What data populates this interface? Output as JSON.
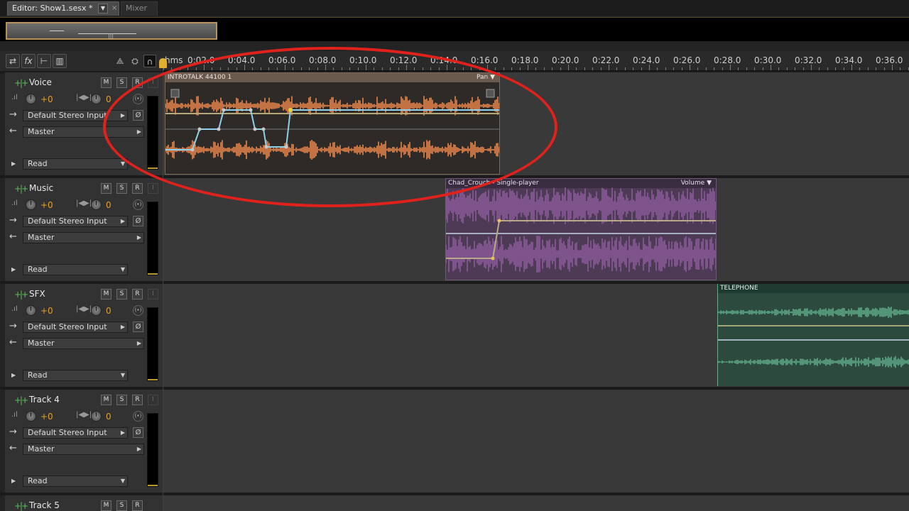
{
  "tabs": [
    {
      "label": "Editor: Show1.sesx *",
      "close": "×"
    },
    {
      "label": "Mixer"
    }
  ],
  "toolbar": {
    "tool_icons": [
      "swap-arrows-icon",
      "fx-icon",
      "sends-icon",
      "eq-icon"
    ],
    "right_icons": [
      "metronome-icon",
      "record-monitor-icon",
      "headphones-icon"
    ],
    "fx_label": "fx"
  },
  "ruler": {
    "units": "hms",
    "ticks": [
      "0:02.0",
      "0:04.0",
      "0:06.0",
      "0:08.0",
      "0:10.0",
      "0:12.0",
      "0:14.0",
      "0:16.0",
      "0:18.0",
      "0:20.0",
      "0:22.0",
      "0:24.0",
      "0:26.0",
      "0:28.0",
      "0:30.0",
      "0:32.0",
      "0:34.0",
      "0:36.0"
    ]
  },
  "tracks": [
    {
      "name": "Voice",
      "m": "M",
      "s": "S",
      "r": "R",
      "i": "I",
      "volume": "+0",
      "pan": "0",
      "input": "Default Stereo Input",
      "output": "Master",
      "automation": "Read"
    },
    {
      "name": "Music",
      "m": "M",
      "s": "S",
      "r": "R",
      "i": "I",
      "volume": "+0",
      "pan": "0",
      "input": "Default Stereo Input",
      "output": "Master",
      "automation": "Read"
    },
    {
      "name": "SFX",
      "m": "M",
      "s": "S",
      "r": "R",
      "i": "I",
      "volume": "+0",
      "pan": "0",
      "input": "Default Stereo Input",
      "output": "Master",
      "automation": "Read"
    },
    {
      "name": "Track 4",
      "m": "M",
      "s": "S",
      "r": "R",
      "i": "I",
      "volume": "+0",
      "pan": "0",
      "input": "Default Stereo Input",
      "output": "Master",
      "automation": "Read"
    },
    {
      "name": "Track 5",
      "m": "M",
      "s": "S",
      "r": "R"
    }
  ],
  "clips": {
    "voice": {
      "name": "INTROTALK 44100 1",
      "envelope": "Pan",
      "color": "#e8844a"
    },
    "music": {
      "name": "Chad_Crouch - Single-player",
      "envelope": "Volume",
      "color": "#8a5a9a"
    },
    "sfx": {
      "name": "TELEPHONE",
      "color": "#4f9a78"
    }
  },
  "colors": {
    "accent": "#e0a030",
    "callout": "#e0211c"
  }
}
